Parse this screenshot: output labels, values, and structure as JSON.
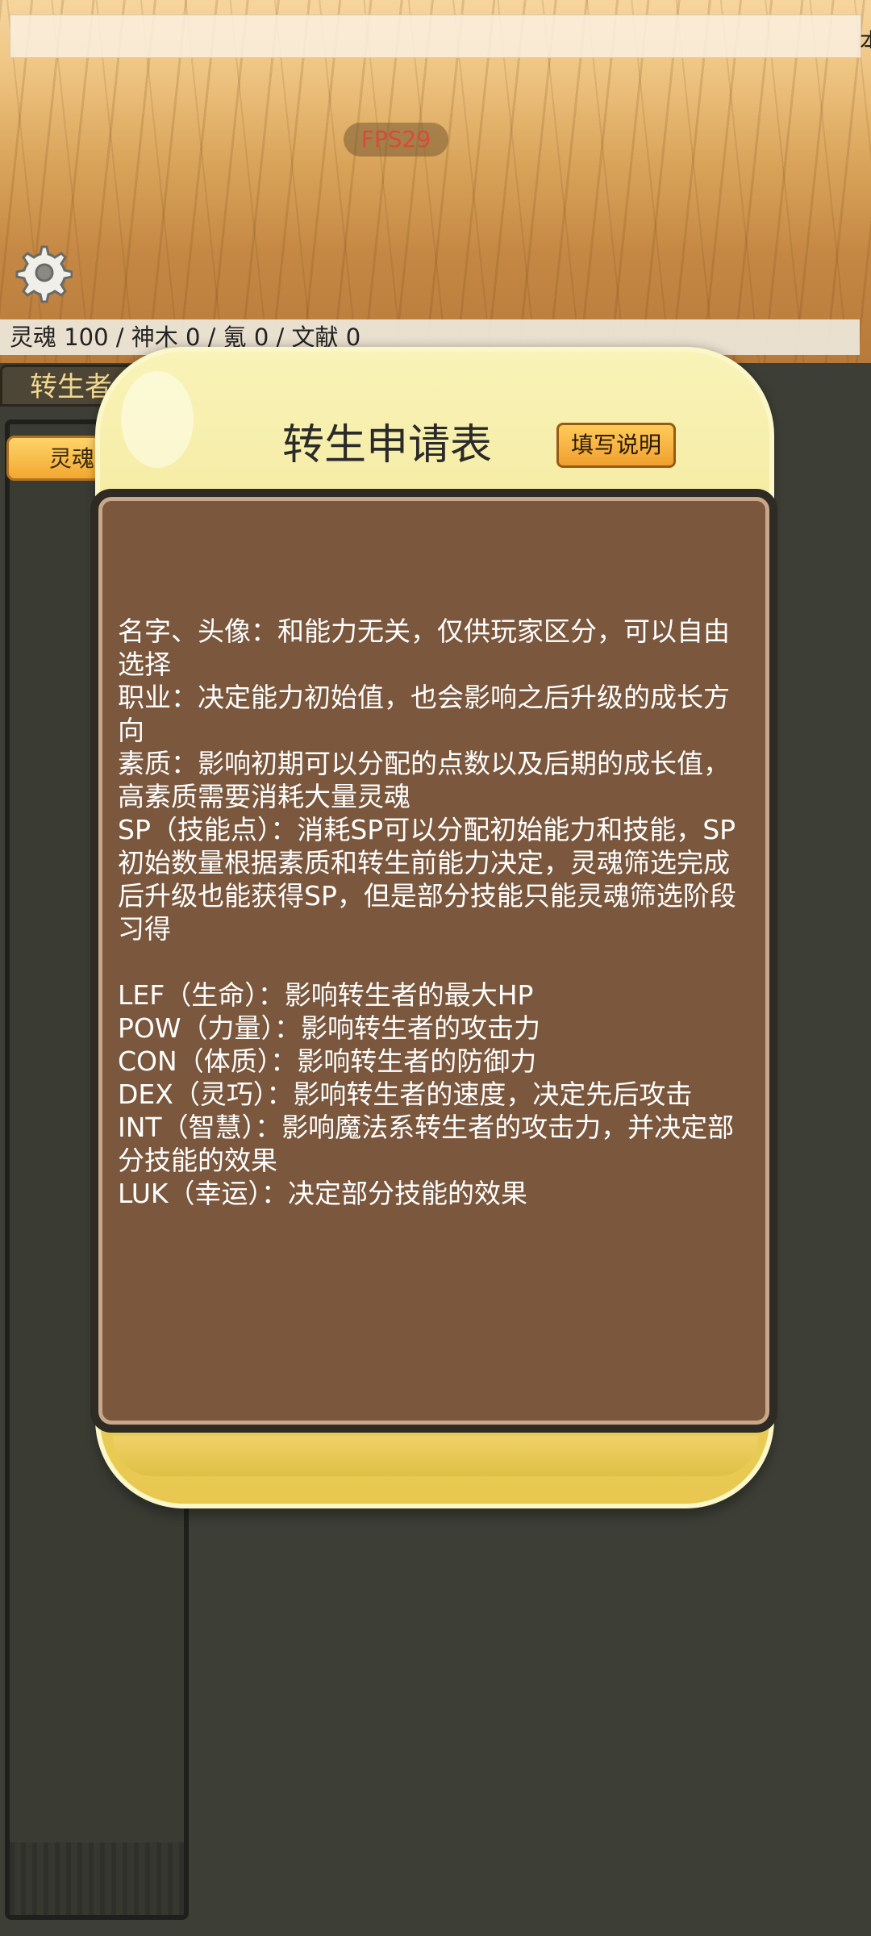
{
  "header": {
    "edge_text": "本",
    "fps": "FPS29"
  },
  "resources": {
    "text": "灵魂 100 / 神木 0 / 氪 0 / 文献 0"
  },
  "left_panel": {
    "tab_label": "转生者",
    "soul_button_label": "灵魂"
  },
  "icons": {
    "settings": "gear-icon"
  },
  "colors": {
    "fps_text": "#d84b3a",
    "modal_yellow": "#f3e28a",
    "content_brown": "#7a573d",
    "button_orange": "#f0a02e"
  },
  "modal": {
    "title": "转生申请表",
    "help_button": "填写说明",
    "body": "名字、头像：和能力无关，仅供玩家区分，可以自由选择\n职业：决定能力初始值，也会影响之后升级的成长方向\n素质：影响初期可以分配的点数以及后期的成长值，高素质需要消耗大量灵魂\nSP（技能点）：消耗SP可以分配初始能力和技能，SP初始数量根据素质和转生前能力决定，灵魂筛选完成后升级也能获得SP，但是部分技能只能灵魂筛选阶段习得\n\nLEF（生命）：影响转生者的最大HP\nPOW（力量）：影响转生者的攻击力\nCON（体质）：影响转生者的防御力\nDEX（灵巧）：影响转生者的速度，决定先后攻击\nINT（智慧）：影响魔法系转生者的攻击力，并决定部分技能的效果\nLUK（幸运）：决定部分技能的效果"
  }
}
